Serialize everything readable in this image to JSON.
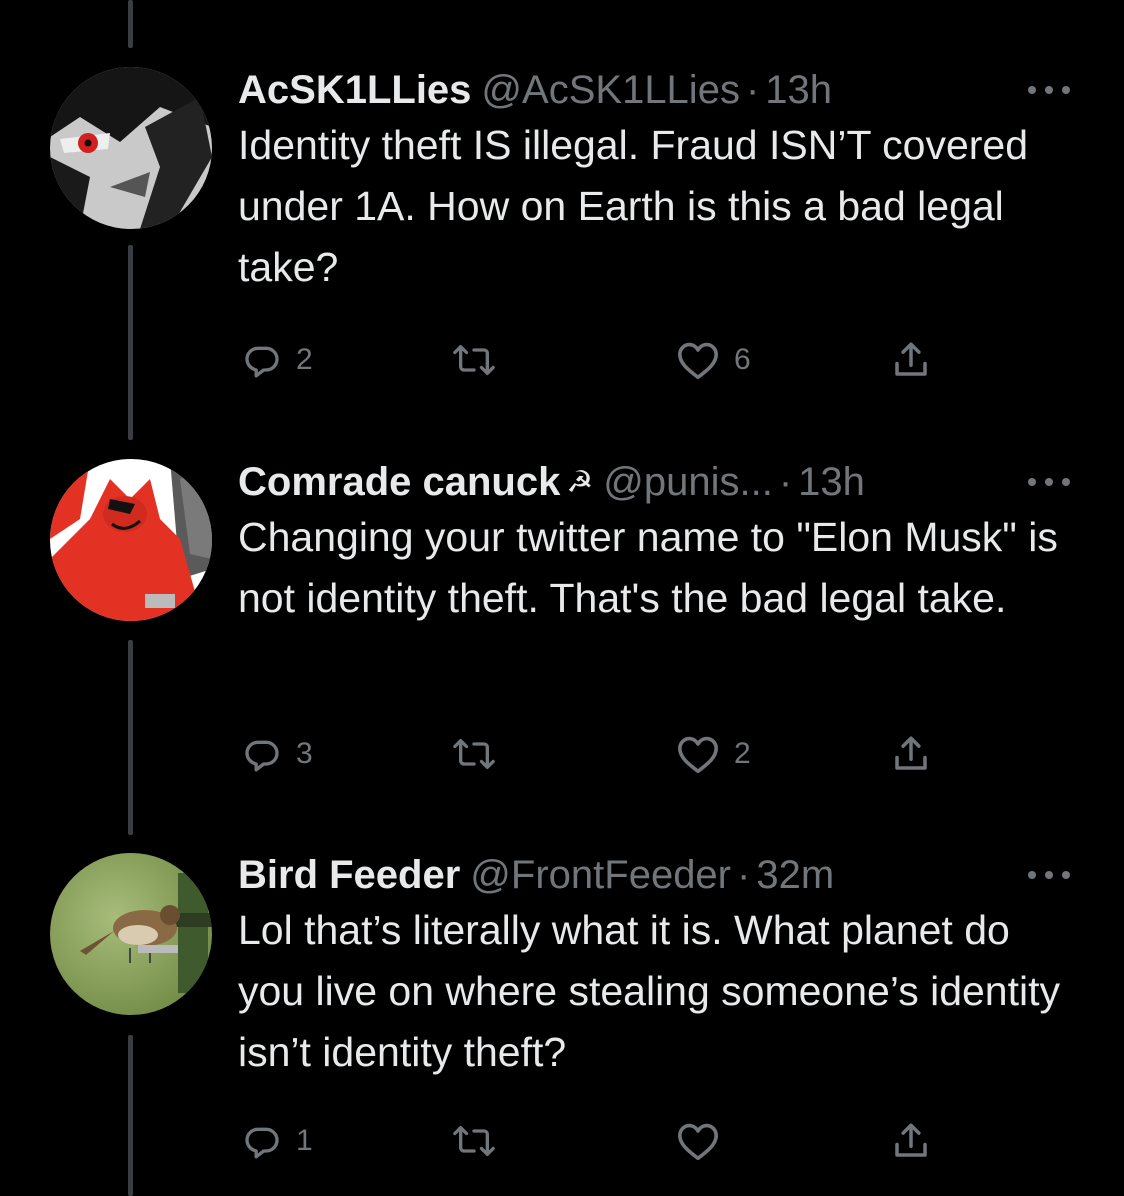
{
  "tweets": [
    {
      "name": "AcSK1LLies",
      "badge": "",
      "handle": "@AcSK1LLies",
      "separator": "·",
      "time": "13h",
      "text": "Identity theft IS illegal. Fraud ISN’T covered under 1A. How on Earth is this a bad legal take?",
      "replies": "2",
      "retweets": "",
      "likes": "6",
      "avatar_desc": "anime-character-red-eye-avatar"
    },
    {
      "name": "Comrade canuck",
      "badge": "☭",
      "handle": "@punis...",
      "separator": "·",
      "time": "13h",
      "text": "Changing your twitter name to \"Elon Musk\" is not identity theft. That's the bad legal take.",
      "replies": "3",
      "retweets": "",
      "likes": "2",
      "avatar_desc": "red-cartoon-character-avatar"
    },
    {
      "name": "Bird Feeder",
      "badge": "",
      "handle": "@FrontFeeder",
      "separator": "·",
      "time": "32m",
      "text": "Lol that’s literally what it is. What planet do you live on where stealing someone’s identity isn’t identity theft?",
      "replies": "1",
      "retweets": "",
      "likes": "",
      "avatar_desc": "sparrow-at-bird-feeder-avatar"
    }
  ],
  "icons": {
    "reply": "reply-icon",
    "retweet": "retweet-icon",
    "like": "like-icon",
    "share": "share-icon",
    "more": "more-icon"
  },
  "colors": {
    "background": "#000000",
    "text": "#e7e9ea",
    "secondary": "#71767b",
    "thread_line": "#3a3d41"
  }
}
